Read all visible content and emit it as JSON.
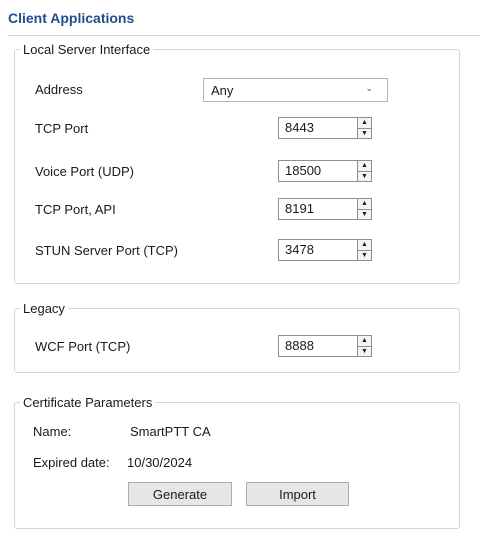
{
  "header": {
    "title": "Client Applications"
  },
  "local_server": {
    "legend": "Local Server Interface",
    "address": {
      "label": "Address",
      "value": "Any"
    },
    "tcp_port": {
      "label": "TCP Port",
      "value": "8443"
    },
    "voice_port": {
      "label": "Voice Port (UDP)",
      "value": "18500"
    },
    "tcp_port_api": {
      "label": "TCP Port, API",
      "value": "8191"
    },
    "stun_port": {
      "label": "STUN Server Port (TCP)",
      "value": "3478"
    }
  },
  "legacy": {
    "legend": "Legacy",
    "wcf_port": {
      "label": "WCF Port (TCP)",
      "value": "8888"
    }
  },
  "certificate": {
    "legend": "Certificate Parameters",
    "name_label": "Name:",
    "name_value": "SmartPTT CA",
    "expired_label": "Expired date:",
    "expired_value": "10/30/2024",
    "generate_label": "Generate",
    "import_label": "Import"
  },
  "icons": {
    "dropdown": "chevron-down-icon",
    "spin_up": "arrow-up-icon",
    "spin_down": "arrow-down-icon"
  }
}
